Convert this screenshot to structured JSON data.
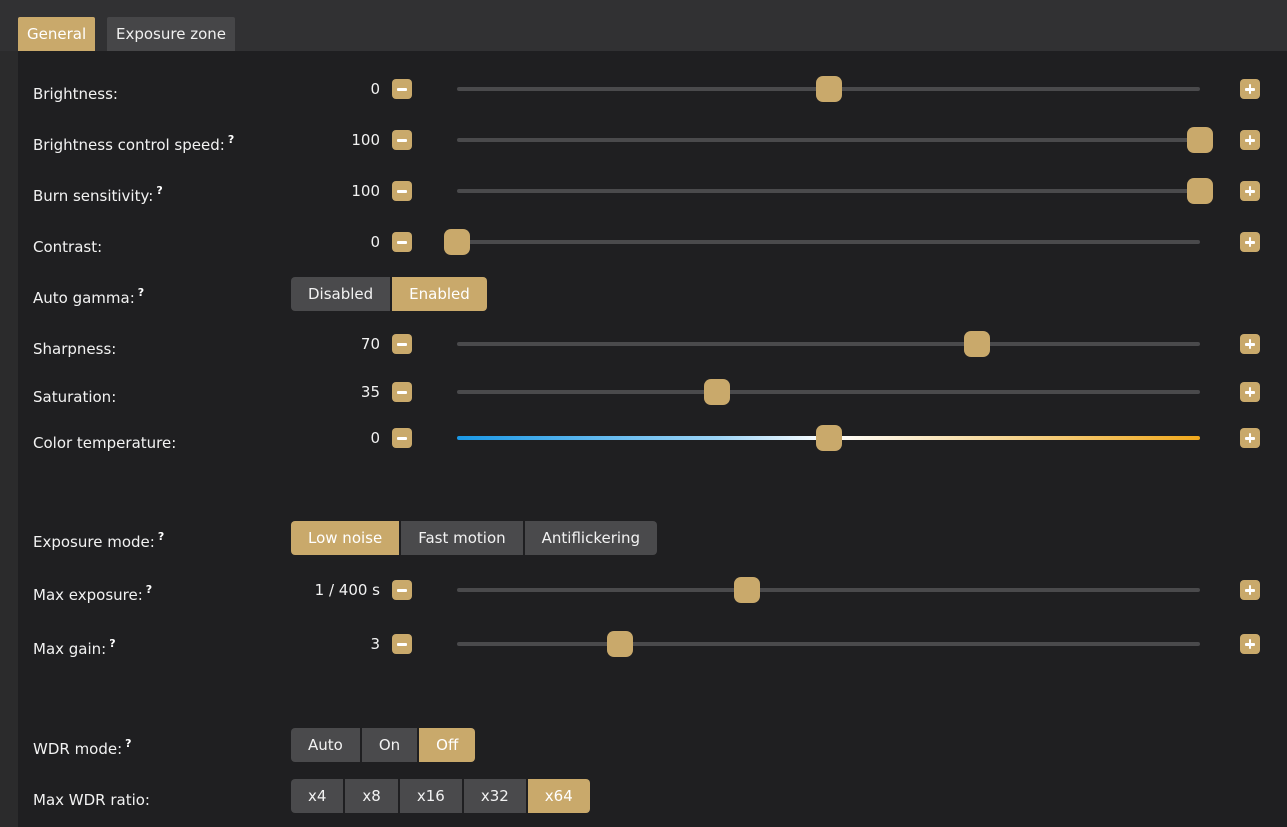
{
  "tabs": [
    {
      "label": "General",
      "active": true
    },
    {
      "label": "Exposure zone",
      "active": false
    }
  ],
  "colors": {
    "accent": "#c9a96b",
    "panel": "#1f1f21",
    "track": "#4a4a4c"
  },
  "sliders": {
    "brightness": {
      "label": "Brightness:",
      "help": "",
      "value": "0",
      "fraction": 0.5
    },
    "brightness_speed": {
      "label": "Brightness control speed:",
      "help": "?",
      "value": "100",
      "fraction": 1.0
    },
    "burn_sensitivity": {
      "label": "Burn sensitivity:",
      "help": "?",
      "value": "100",
      "fraction": 1.0
    },
    "contrast": {
      "label": "Contrast:",
      "help": "",
      "value": "0",
      "fraction": 0.0
    },
    "sharpness": {
      "label": "Sharpness:",
      "help": "",
      "value": "70",
      "fraction": 0.7
    },
    "saturation": {
      "label": "Saturation:",
      "help": "",
      "value": "35",
      "fraction": 0.35
    },
    "color_temperature": {
      "label": "Color temperature:",
      "help": "",
      "value": "0",
      "fraction": 0.5
    },
    "max_exposure": {
      "label": "Max exposure:",
      "help": "?",
      "value": "1 / 400 s",
      "fraction": 0.39
    },
    "max_gain": {
      "label": "Max gain:",
      "help": "?",
      "value": "3",
      "fraction": 0.22
    }
  },
  "auto_gamma": {
    "label": "Auto gamma:",
    "help": "?",
    "options": [
      "Disabled",
      "Enabled"
    ],
    "selected": "Enabled"
  },
  "exposure_mode": {
    "label": "Exposure mode:",
    "help": "?",
    "options": [
      "Low noise",
      "Fast motion",
      "Antiflickering"
    ],
    "selected": "Low noise"
  },
  "wdr_mode": {
    "label": "WDR mode:",
    "help": "?",
    "options": [
      "Auto",
      "On",
      "Off"
    ],
    "selected": "Off"
  },
  "max_wdr_ratio": {
    "label": "Max WDR ratio:",
    "help": "",
    "options": [
      "x4",
      "x8",
      "x16",
      "x32",
      "x64"
    ],
    "selected": "x64"
  }
}
